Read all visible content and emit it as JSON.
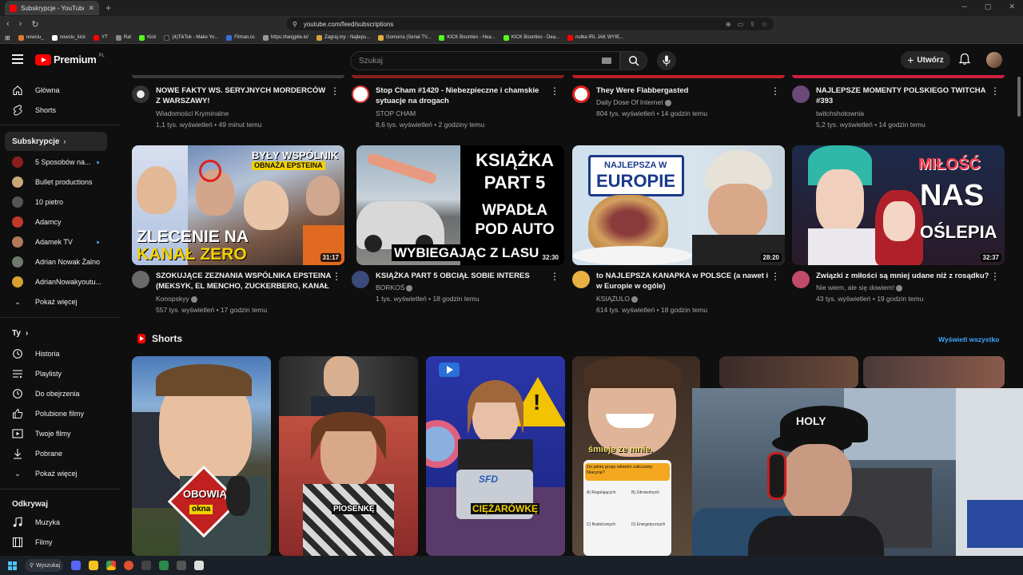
{
  "browser": {
    "tab_title": "Subskrypcje - YouTube",
    "url": "youtube.com/feed/subscriptions",
    "bookmarks": [
      "nowciu_",
      "nowciu_kick",
      "YT",
      "Rat",
      "Kick",
      "(4)TikTok - Make Yo...",
      "Filman.cc",
      "https://tangpile.io/",
      "Zagraj.my - Najleps...",
      "Gomorra (Serial TV...",
      "KICK Bounties - Hea...",
      "KICK Bounties - Dea...",
      "nutka IRL JAK WYIE..."
    ]
  },
  "header": {
    "logo_text": "Premium",
    "logo_country": "PL",
    "search_placeholder": "Szukaj",
    "create_label": "Utwórz"
  },
  "sidebar": {
    "main": [
      {
        "label": "Główna",
        "icon": "home-icon"
      },
      {
        "label": "Shorts",
        "icon": "shorts-icon"
      }
    ],
    "subs_heading": "Subskrypcje",
    "subs": [
      {
        "label": "5 Sposobów na...",
        "color": "#8b1e1e",
        "dot": true
      },
      {
        "label": "Bullet productions",
        "color": "#c9a97a",
        "dot": false
      },
      {
        "label": "10 pietro",
        "color": "#555555",
        "dot": false
      },
      {
        "label": "Adamcy",
        "color": "#c0392b",
        "dot": false
      },
      {
        "label": "Adamek TV",
        "color": "#b07a5a",
        "dot": true
      },
      {
        "label": "Adrian Nowak Żalno",
        "color": "#6d7a6a",
        "dot": false
      },
      {
        "label": "AdrianNowakyoutu...",
        "color": "#d9a030",
        "dot": false
      }
    ],
    "subs_more": "Pokaż więcej",
    "you_heading": "Ty",
    "you": [
      {
        "label": "Historia",
        "icon": "history-icon"
      },
      {
        "label": "Playlisty",
        "icon": "playlist-icon"
      },
      {
        "label": "Do obejrzenia",
        "icon": "clock-icon"
      },
      {
        "label": "Polubione filmy",
        "icon": "thumbs-up-icon"
      },
      {
        "label": "Twoje filmy",
        "icon": "video-icon"
      },
      {
        "label": "Pobrane",
        "icon": "download-icon"
      }
    ],
    "you_more": "Pokaż więcej",
    "explore_heading": "Odkrywaj",
    "explore": [
      {
        "label": "Muzyka",
        "icon": "music-icon"
      },
      {
        "label": "Filmy",
        "icon": "film-icon"
      }
    ]
  },
  "row1": [
    {
      "title": "NOWE FAKTY WS. SERYJNYCH MORDERCÓW Z WARSZAWY!",
      "channel": "Wiadomości Kryminalne",
      "stats": "1,1 tys. wyświetleń • 49 minut temu",
      "verified": false
    },
    {
      "title": "Stop Cham #1420 - Niebezpieczne i chamskie sytuacje na drogach",
      "channel": "STOP CHAM",
      "stats": "8,6 tys. wyświetleń • 2 godziny temu",
      "verified": false
    },
    {
      "title": "They Were Flabbergasted",
      "channel": "Daily Dose Of Internet",
      "stats": "804 tys. wyświetleń • 14 godzin temu",
      "verified": true
    },
    {
      "title": "NAJLEPSZE MOMENTY POLSKIEGO TWITCHA #393",
      "channel": "twitchshotownia",
      "stats": "5,2 tys. wyświetleń • 14 godzin temu",
      "verified": false
    }
  ],
  "row2": [
    {
      "title": "SZOKUJĄCE ZEZNANIA WSPÓLNIKA EPSTEINA (MEKSYK, EL MENCHO, ZUCKERBERG, KANAŁ ...",
      "channel": "Konopskyy",
      "stats": "557 tys. wyświetleń • 17 godzin temu",
      "duration": "31:17",
      "verified": true,
      "thumb_top": "BYŁY WSPÓLNIK",
      "thumb_top2": "OBNAŻA EPSTEINA",
      "thumb_main": "ZLECENIE NA",
      "thumb_main2": "KANAŁ ZERO"
    },
    {
      "title": "KSIĄŻKA PART 5 OBCIĄŁ SOBIE INTERES",
      "channel": "BORKOŚ",
      "stats": "1 tys. wyświetleń • 18 godzin temu",
      "duration": "32:30",
      "verified": true,
      "thumb_l1": "KSIĄŻKA",
      "thumb_l2": "PART 5",
      "thumb_l3": "WPADŁA",
      "thumb_l4": "POD AUTO",
      "thumb_l5": "WYBIEGAJĄC Z LASU"
    },
    {
      "title": "to NAJLEPSZA KANAPKA w POLSCE (a nawet i w Europie w ogóle)",
      "channel": "KSIĄŻULO",
      "stats": "614 tys. wyświetleń • 18 godzin temu",
      "duration": "28:20",
      "verified": true,
      "thumb_l1": "NAJLEPSZA W",
      "thumb_l2": "EUROPIE"
    },
    {
      "title": "Związki z miłości są mniej udane niż z rosądku?",
      "channel": "Nie wiem, ale się dowiem!",
      "stats": "43 tys. wyświetleń • 19 godzin temu",
      "duration": "32:37",
      "verified": true,
      "thumb_l1": "MIŁOŚĆ",
      "thumb_l2": "NAS",
      "thumb_l3": "OŚLEPIA"
    }
  ],
  "shorts": {
    "heading": "Shorts",
    "see_all": "Wyświetl wszystko",
    "items": [
      {
        "caption1": "OBOWIĄ",
        "caption2": "okna"
      },
      {
        "caption1": "PIOSENKĘ"
      },
      {
        "caption1": "SFD",
        "caption2": "CIĘŻARÓWKĘ"
      },
      {
        "caption1": "śmieje ze mnie.",
        "quiz_q": "Do jakiej grupy witamin zaliczamy Niacynę?",
        "a": "A) Regulujących",
        "b": "B) Zdrowotnych",
        "c": "C) Budulcowych",
        "d": "D) Energetycznych"
      }
    ]
  },
  "webcam": {
    "cap_text": "HOLY"
  },
  "taskbar": {
    "search_label": "Wyszukaj"
  }
}
